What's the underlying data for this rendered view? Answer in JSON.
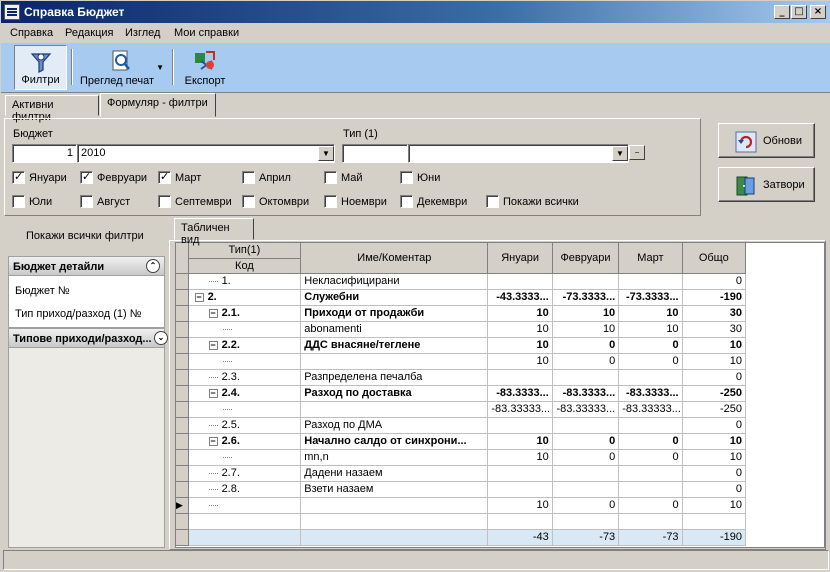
{
  "window": {
    "title": "Справка Бюджет"
  },
  "menu": [
    "Справка",
    "Редакция",
    "Изглед",
    "Мои справки"
  ],
  "toolbar": {
    "filters": "Филтри",
    "print_preview": "Преглед печат",
    "export": "Експорт"
  },
  "tabs": [
    "Активни филтри",
    "Формуляр - филтри"
  ],
  "filters": {
    "budget_label": "Бюджет",
    "budget_code": "1",
    "budget_name": "2010",
    "type_label": "Тип (1)",
    "months": [
      {
        "label": "Януари",
        "checked": true
      },
      {
        "label": "Февруари",
        "checked": true
      },
      {
        "label": "Март",
        "checked": true
      },
      {
        "label": "Април",
        "checked": false
      },
      {
        "label": "Май",
        "checked": false
      },
      {
        "label": "Юни",
        "checked": false
      },
      {
        "label": "Юли",
        "checked": false
      },
      {
        "label": "Август",
        "checked": false
      },
      {
        "label": "Септември",
        "checked": false
      },
      {
        "label": "Октомври",
        "checked": false
      },
      {
        "label": "Ноември",
        "checked": false
      },
      {
        "label": "Декември",
        "checked": false
      }
    ],
    "show_all": "Покажи всички",
    "show_all_checked": false
  },
  "buttons": {
    "refresh": "Обнови",
    "close": "Затвори"
  },
  "left": {
    "show_all_filters": "Покажи всички филтри",
    "group1_title": "Бюджет детайли",
    "group1_items": [
      "Бюджет №",
      "Тип приход/разход (1) №"
    ],
    "group2_title": "Типове приходи/разход..."
  },
  "grid": {
    "tab": "Табличен вид",
    "headers": {
      "type": "Тип(1)",
      "code": "Код",
      "name": "Име/Коментар",
      "m1": "Януари",
      "m2": "Февруари",
      "m3": "Март",
      "total": "Общо"
    },
    "rows": [
      {
        "code": "1.",
        "name": "Некласифицирани",
        "m1": "",
        "m2": "",
        "m3": "",
        "total": "0",
        "bold": false
      },
      {
        "code": "2.",
        "name": "Служебни",
        "m1": "-43.3333...",
        "m2": "-73.3333...",
        "m3": "-73.3333...",
        "total": "-190",
        "bold": true
      },
      {
        "code": "2.1.",
        "name": "Приходи от продажби",
        "m1": "10",
        "m2": "10",
        "m3": "10",
        "total": "30",
        "bold": true
      },
      {
        "code": "",
        "name": "abonamenti",
        "m1": "10",
        "m2": "10",
        "m3": "10",
        "total": "30",
        "bold": false
      },
      {
        "code": "2.2.",
        "name": "ДДС внасяне/теглене",
        "m1": "10",
        "m2": "0",
        "m3": "0",
        "total": "10",
        "bold": true
      },
      {
        "code": "",
        "name": "",
        "m1": "10",
        "m2": "0",
        "m3": "0",
        "total": "10",
        "bold": false
      },
      {
        "code": "2.3.",
        "name": "Разпределена печалба",
        "m1": "",
        "m2": "",
        "m3": "",
        "total": "0",
        "bold": false
      },
      {
        "code": "2.4.",
        "name": "Разход по доставка",
        "m1": "-83.3333...",
        "m2": "-83.3333...",
        "m3": "-83.3333...",
        "total": "-250",
        "bold": true
      },
      {
        "code": "",
        "name": "",
        "m1": "-83.33333...",
        "m2": "-83.33333...",
        "m3": "-83.33333...",
        "total": "-250",
        "bold": false
      },
      {
        "code": "2.5.",
        "name": "Разход по ДМА",
        "m1": "",
        "m2": "",
        "m3": "",
        "total": "0",
        "bold": false
      },
      {
        "code": "2.6.",
        "name": "Начално салдо от синхрони...",
        "m1": "10",
        "m2": "0",
        "m3": "0",
        "total": "10",
        "bold": true
      },
      {
        "code": "",
        "name": "mn,n",
        "m1": "10",
        "m2": "0",
        "m3": "0",
        "total": "10",
        "bold": false
      },
      {
        "code": "2.7.",
        "name": "Дадени назаем",
        "m1": "",
        "m2": "",
        "m3": "",
        "total": "0",
        "bold": false
      },
      {
        "code": "2.8.",
        "name": "Взети назаем",
        "m1": "",
        "m2": "",
        "m3": "",
        "total": "0",
        "bold": false
      },
      {
        "code": "",
        "name": "",
        "m1": "10",
        "m2": "0",
        "m3": "0",
        "total": "10",
        "bold": false
      }
    ],
    "footer": {
      "m1": "-43",
      "m2": "-73",
      "m3": "-73",
      "total": "-190"
    }
  }
}
